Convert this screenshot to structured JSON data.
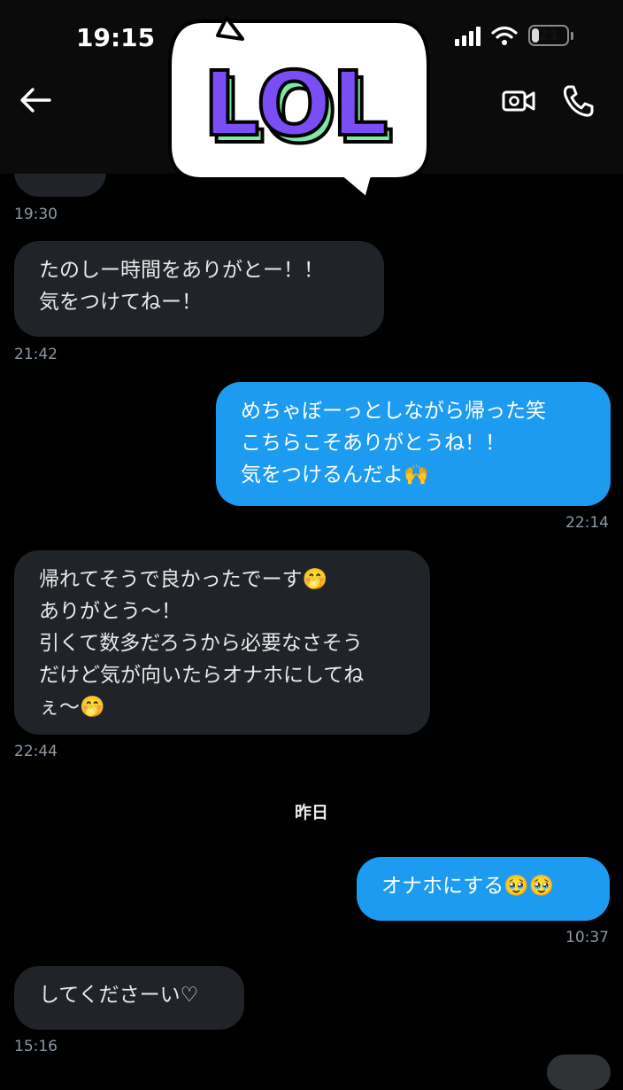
{
  "status_bar": {
    "time": "19:15",
    "battery": "21",
    "battery_level": 0.21
  },
  "header": {
    "sticker_text": "LOL",
    "back_icon": "arrow-left-icon",
    "video_icon": "video-camera-icon",
    "call_icon": "phone-icon"
  },
  "messages": [
    {
      "side": "in",
      "text": "たのしー時間をありがとー！！\n気をつけてねー！",
      "time": "21:42"
    },
    {
      "side": "out",
      "text": "めちゃぼーっとしながら帰った笑\nこちらこそありがとうね！！\n気をつけるんだよ🙌",
      "time": "22:14"
    },
    {
      "side": "in",
      "text": "帰れてそうで良かったでーす🤭\nありがとう〜！\n引くて数多だろうから必要なさそう\nだけど気が向いたらオナホにしてね\nぇ〜🤭",
      "time": "22:44"
    },
    {
      "side": "out",
      "text": "オナホにする🥹🥹",
      "time": "10:37"
    },
    {
      "side": "in",
      "text": "してくださーい♡",
      "time": "15:16"
    }
  ],
  "earlier_time": "19:30",
  "date_separator": "昨日",
  "colors": {
    "incoming": "#202327",
    "outgoing": "#1d9bf0",
    "background": "#000000",
    "sticker_purple": "#7b4ef5",
    "sticker_green": "#7ee8a8"
  }
}
